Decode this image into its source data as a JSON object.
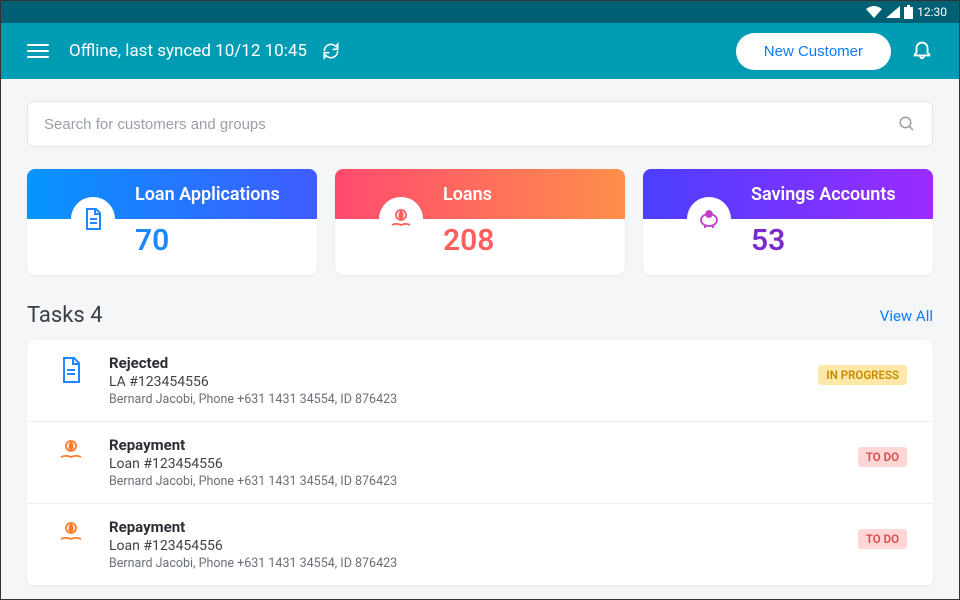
{
  "statusbar": {
    "time": "12:30"
  },
  "topbar": {
    "sync_text": "Offline, last synced 10/12 10:45",
    "new_customer_label": "New Customer"
  },
  "search": {
    "placeholder": "Search for customers and groups"
  },
  "cards": {
    "loan_apps": {
      "title": "Loan Applications",
      "count": "70"
    },
    "loans": {
      "title": "Loans",
      "count": "208"
    },
    "savings": {
      "title": "Savings Accounts",
      "count": "53"
    }
  },
  "tasks": {
    "header": "Tasks 4",
    "view_all": "View All",
    "items": [
      {
        "title": "Rejected",
        "sub": "LA #123454556",
        "detail": "Bernard Jacobi, Phone +631 1431 34554, ID 876423",
        "badge": "IN PROGRESS",
        "badge_class": "badge-inprogress",
        "icon": "document"
      },
      {
        "title": "Repayment",
        "sub": "Loan #123454556",
        "detail": "Bernard Jacobi, Phone +631 1431 34554, ID 876423",
        "badge": "TO DO",
        "badge_class": "badge-todo",
        "icon": "money"
      },
      {
        "title": "Repayment",
        "sub": "Loan #123454556",
        "detail": "Bernard Jacobi, Phone +631 1431 34554, ID 876423",
        "badge": "TO DO",
        "badge_class": "badge-todo",
        "icon": "money"
      }
    ]
  }
}
